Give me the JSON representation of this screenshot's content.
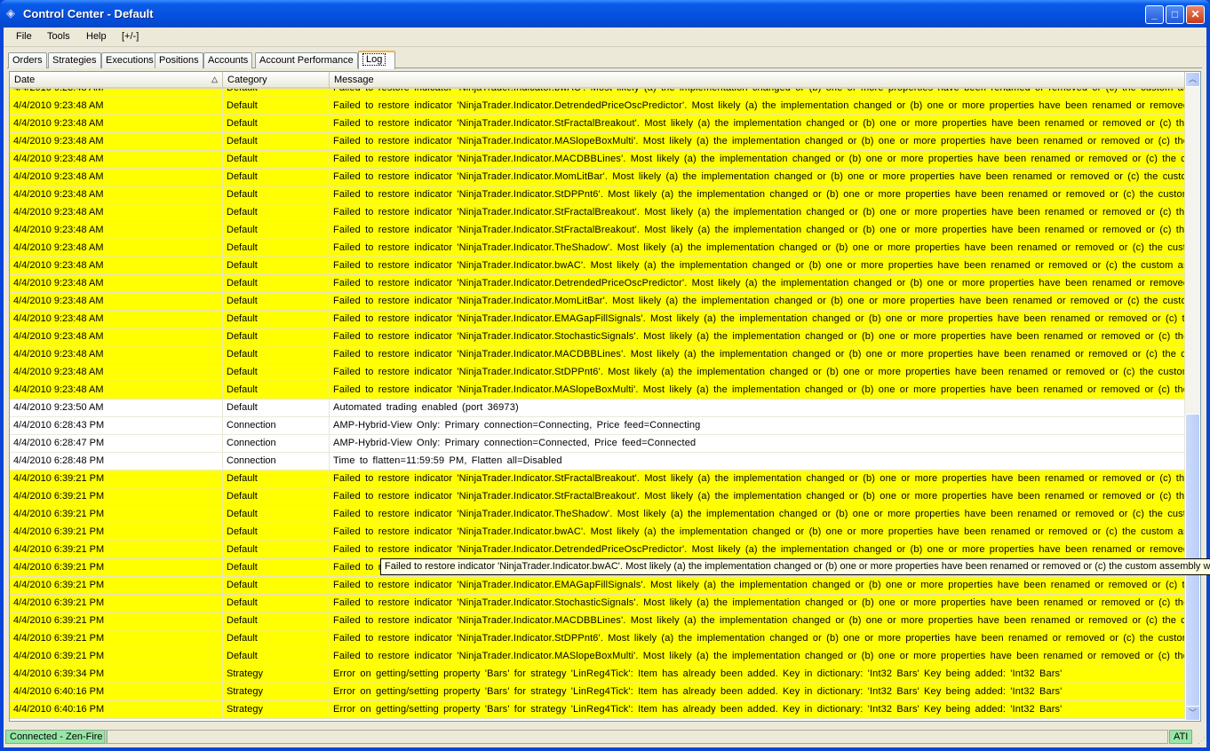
{
  "window": {
    "title": "Control Center - Default",
    "minimize": "_",
    "maximize": "□",
    "close": "✕",
    "icon": "diamond-app-icon"
  },
  "menu": [
    "File",
    "Tools",
    "Help",
    "[+/-]"
  ],
  "tabs": [
    {
      "label": "Orders"
    },
    {
      "label": "Strategies"
    },
    {
      "label": "Executions"
    },
    {
      "label": "Positions"
    },
    {
      "label": "Accounts"
    },
    {
      "label": "Account Performance"
    },
    {
      "label": "Log",
      "active": true
    }
  ],
  "columns": {
    "date": "Date",
    "category": "Category",
    "message": "Message",
    "sort_indicator": "△"
  },
  "colors": {
    "highlight": "#ffff00",
    "normal": "#ffffff"
  },
  "rows": [
    {
      "date": "4/4/2010 9:23:48 AM",
      "category": "Default",
      "message": "Failed to restore indicator 'NinjaTrader.Indicator.bwAC'. Most likely (a) the implementation changed or (b) one or more properties have been renamed or removed or (c) the custom assembly w",
      "highlight": true
    },
    {
      "date": "4/4/2010 9:23:48 AM",
      "category": "Default",
      "message": "Failed to restore indicator 'NinjaTrader.Indicator.DetrendedPriceOscPredictor'. Most likely (a) the implementation changed or (b) one or more properties have been renamed or removed or (c) t",
      "highlight": true
    },
    {
      "date": "4/4/2010 9:23:48 AM",
      "category": "Default",
      "message": "Failed to restore indicator 'NinjaTrader.Indicator.StFractalBreakout'. Most likely (a) the implementation changed or (b) one or more properties have been renamed or removed or (c) the custom",
      "highlight": true
    },
    {
      "date": "4/4/2010 9:23:48 AM",
      "category": "Default",
      "message": "Failed to restore indicator 'NinjaTrader.Indicator.MASlopeBoxMulti'. Most likely (a) the implementation changed or (b) one or more properties have been renamed or removed or (c) the custom",
      "highlight": true
    },
    {
      "date": "4/4/2010 9:23:48 AM",
      "category": "Default",
      "message": "Failed to restore indicator 'NinjaTrader.Indicator.MACDBBLines'. Most likely (a) the implementation changed or (b) one or more properties have been renamed or removed or (c) the custom as",
      "highlight": true
    },
    {
      "date": "4/4/2010 9:23:48 AM",
      "category": "Default",
      "message": "Failed to restore indicator 'NinjaTrader.Indicator.MomLitBar'. Most likely (a) the implementation changed or (b) one or more properties have been renamed or removed or (c) the custom assem",
      "highlight": true
    },
    {
      "date": "4/4/2010 9:23:48 AM",
      "category": "Default",
      "message": "Failed to restore indicator 'NinjaTrader.Indicator.StDPPnt6'. Most likely (a) the implementation changed or (b) one or more properties have been renamed or removed or (c) the custom assemb",
      "highlight": true
    },
    {
      "date": "4/4/2010 9:23:48 AM",
      "category": "Default",
      "message": "Failed to restore indicator 'NinjaTrader.Indicator.StFractalBreakout'. Most likely (a) the implementation changed or (b) one or more properties have been renamed or removed or (c) the custom",
      "highlight": true
    },
    {
      "date": "4/4/2010 9:23:48 AM",
      "category": "Default",
      "message": "Failed to restore indicator 'NinjaTrader.Indicator.StFractalBreakout'. Most likely (a) the implementation changed or (b) one or more properties have been renamed or removed or (c) the custom",
      "highlight": true
    },
    {
      "date": "4/4/2010 9:23:48 AM",
      "category": "Default",
      "message": "Failed to restore indicator 'NinjaTrader.Indicator.TheShadow'. Most likely (a) the implementation changed or (b) one or more properties have been renamed or removed or (c) the custom asse",
      "highlight": true
    },
    {
      "date": "4/4/2010 9:23:48 AM",
      "category": "Default",
      "message": "Failed to restore indicator 'NinjaTrader.Indicator.bwAC'. Most likely (a) the implementation changed or (b) one or more properties have been renamed or removed or (c) the custom assembly w",
      "highlight": true
    },
    {
      "date": "4/4/2010 9:23:48 AM",
      "category": "Default",
      "message": "Failed to restore indicator 'NinjaTrader.Indicator.DetrendedPriceOscPredictor'. Most likely (a) the implementation changed or (b) one or more properties have been renamed or removed or (c) t",
      "highlight": true
    },
    {
      "date": "4/4/2010 9:23:48 AM",
      "category": "Default",
      "message": "Failed to restore indicator 'NinjaTrader.Indicator.MomLitBar'. Most likely (a) the implementation changed or (b) one or more properties have been renamed or removed or (c) the custom assem",
      "highlight": true
    },
    {
      "date": "4/4/2010 9:23:48 AM",
      "category": "Default",
      "message": "Failed to restore indicator 'NinjaTrader.Indicator.EMAGapFillSignals'. Most likely (a) the implementation changed or (b) one or more properties have been renamed or removed or (c) the custo",
      "highlight": true
    },
    {
      "date": "4/4/2010 9:23:48 AM",
      "category": "Default",
      "message": "Failed to restore indicator 'NinjaTrader.Indicator.StochasticSignals'. Most likely (a) the implementation changed or (b) one or more properties have been renamed or removed or (c) the custom",
      "highlight": true
    },
    {
      "date": "4/4/2010 9:23:48 AM",
      "category": "Default",
      "message": "Failed to restore indicator 'NinjaTrader.Indicator.MACDBBLines'. Most likely (a) the implementation changed or (b) one or more properties have been renamed or removed or (c) the custom as",
      "highlight": true
    },
    {
      "date": "4/4/2010 9:23:48 AM",
      "category": "Default",
      "message": "Failed to restore indicator 'NinjaTrader.Indicator.StDPPnt6'. Most likely (a) the implementation changed or (b) one or more properties have been renamed or removed or (c) the custom assemb",
      "highlight": true
    },
    {
      "date": "4/4/2010 9:23:48 AM",
      "category": "Default",
      "message": "Failed to restore indicator 'NinjaTrader.Indicator.MASlopeBoxMulti'. Most likely (a) the implementation changed or (b) one or more properties have been renamed or removed or (c) the custom",
      "highlight": true
    },
    {
      "date": "4/4/2010 9:23:50 AM",
      "category": "Default",
      "message": "Automated trading enabled (port 36973)",
      "highlight": false
    },
    {
      "date": "4/4/2010 6:28:43 PM",
      "category": "Connection",
      "message": "AMP-Hybrid-View Only: Primary connection=Connecting, Price feed=Connecting",
      "highlight": false
    },
    {
      "date": "4/4/2010 6:28:47 PM",
      "category": "Connection",
      "message": "AMP-Hybrid-View Only: Primary connection=Connected, Price feed=Connected",
      "highlight": false
    },
    {
      "date": "4/4/2010 6:28:48 PM",
      "category": "Connection",
      "message": "Time to flatten=11:59:59 PM, Flatten all=Disabled",
      "highlight": false
    },
    {
      "date": "4/4/2010 6:39:21 PM",
      "category": "Default",
      "message": "Failed to restore indicator 'NinjaTrader.Indicator.StFractalBreakout'. Most likely (a) the implementation changed or (b) one or more properties have been renamed or removed or (c) the custom",
      "highlight": true
    },
    {
      "date": "4/4/2010 6:39:21 PM",
      "category": "Default",
      "message": "Failed to restore indicator 'NinjaTrader.Indicator.StFractalBreakout'. Most likely (a) the implementation changed or (b) one or more properties have been renamed or removed or (c) the custom",
      "highlight": true
    },
    {
      "date": "4/4/2010 6:39:21 PM",
      "category": "Default",
      "message": "Failed to restore indicator 'NinjaTrader.Indicator.TheShadow'. Most likely (a) the implementation changed or (b) one or more properties have been renamed or removed or (c) the custom asse",
      "highlight": true
    },
    {
      "date": "4/4/2010 6:39:21 PM",
      "category": "Default",
      "message": "Failed to restore indicator 'NinjaTrader.Indicator.bwAC'. Most likely (a) the implementation changed or (b) one or more properties have been renamed or removed or (c) the custom assembly w",
      "highlight": true
    },
    {
      "date": "4/4/2010 6:39:21 PM",
      "category": "Default",
      "message": "Failed to restore indicator 'NinjaTrader.Indicator.DetrendedPriceOscPredictor'. Most likely (a) the implementation changed or (b) one or more properties have been renamed or removed or (c) t",
      "highlight": true
    },
    {
      "date": "4/4/2010 6:39:21 PM",
      "category": "Default",
      "message": "Failed to restore indicator 'NinjaTrader.Indicator.bwAC'. Most likely (a) the implementation changed or (b) one or more properties have been renamed or removed or (c) the custom assembly w",
      "highlight": true
    },
    {
      "date": "4/4/2010 6:39:21 PM",
      "category": "Default",
      "message": "Failed to restore indicator 'NinjaTrader.Indicator.EMAGapFillSignals'. Most likely (a) the implementation changed or (b) one or more properties have been renamed or removed or (c) the custo",
      "highlight": true
    },
    {
      "date": "4/4/2010 6:39:21 PM",
      "category": "Default",
      "message": "Failed to restore indicator 'NinjaTrader.Indicator.StochasticSignals'. Most likely (a) the implementation changed or (b) one or more properties have been renamed or removed or (c) the custom",
      "highlight": true
    },
    {
      "date": "4/4/2010 6:39:21 PM",
      "category": "Default",
      "message": "Failed to restore indicator 'NinjaTrader.Indicator.MACDBBLines'. Most likely (a) the implementation changed or (b) one or more properties have been renamed or removed or (c) the custom as",
      "highlight": true
    },
    {
      "date": "4/4/2010 6:39:21 PM",
      "category": "Default",
      "message": "Failed to restore indicator 'NinjaTrader.Indicator.StDPPnt6'. Most likely (a) the implementation changed or (b) one or more properties have been renamed or removed or (c) the custom assemb",
      "highlight": true
    },
    {
      "date": "4/4/2010 6:39:21 PM",
      "category": "Default",
      "message": "Failed to restore indicator 'NinjaTrader.Indicator.MASlopeBoxMulti'. Most likely (a) the implementation changed or (b) one or more properties have been renamed or removed or (c) the custom",
      "highlight": true
    },
    {
      "date": "4/4/2010 6:39:34 PM",
      "category": "Strategy",
      "message": "Error on getting/setting property 'Bars' for strategy 'LinReg4Tick': Item has already been added. Key in dictionary: 'Int32 Bars'  Key being added: 'Int32 Bars'",
      "highlight": true
    },
    {
      "date": "4/4/2010 6:40:16 PM",
      "category": "Strategy",
      "message": "Error on getting/setting property 'Bars' for strategy 'LinReg4Tick': Item has already been added. Key in dictionary: 'Int32 Bars'  Key being added: 'Int32 Bars'",
      "highlight": true
    },
    {
      "date": "4/4/2010 6:40:16 PM",
      "category": "Strategy",
      "message": "Error on getting/setting property 'Bars' for strategy 'LinReg4Tick': Item has already been added. Key in dictionary: 'Int32 Bars'  Key being added: 'Int32 Bars'",
      "highlight": true
    }
  ],
  "tooltip": "Failed to restore indicator 'NinjaTrader.Indicator.bwAC'. Most likely (a) the implementation changed or (b) one or more properties have been renamed or removed or (c) the custom assembly which",
  "scrollbar": {
    "up": "︿",
    "down": "﹀",
    "position_percent": 90
  },
  "status": {
    "connection": "Connected - Zen-Fire",
    "right": "ATI",
    "grip": "⋰"
  }
}
